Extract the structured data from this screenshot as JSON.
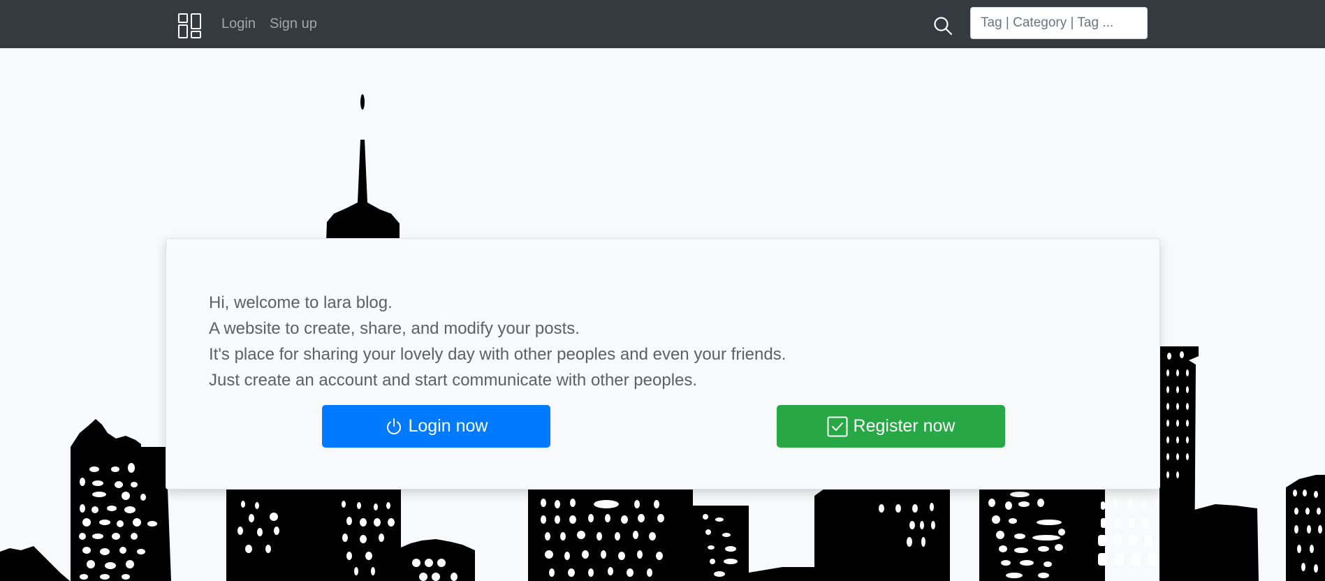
{
  "colors": {
    "navbar": "#343a40",
    "page_background": "#f8f9fa",
    "primary_button": "#007bff",
    "success_button": "#28a745"
  },
  "navbar": {
    "brand_icon": "grid-icon",
    "links": [
      {
        "label": "Login"
      },
      {
        "label": "Sign up"
      }
    ],
    "search_icon": "search-icon",
    "search_placeholder": "Tag | Category | Tag ..."
  },
  "hero": {
    "lines": [
      "Hi, welcome to lara blog.",
      "A website to create, share, and modify your posts.",
      "It's place for sharing your lovely day with other peoples and even your friends.",
      "Just create an account and start communicate with other peoples."
    ],
    "login_button": {
      "label": "Login now",
      "icon": "power-icon"
    },
    "register_button": {
      "label": "Register now",
      "icon": "checkbox-icon"
    }
  },
  "background": {
    "illustration": "city-skyline-silhouette"
  }
}
